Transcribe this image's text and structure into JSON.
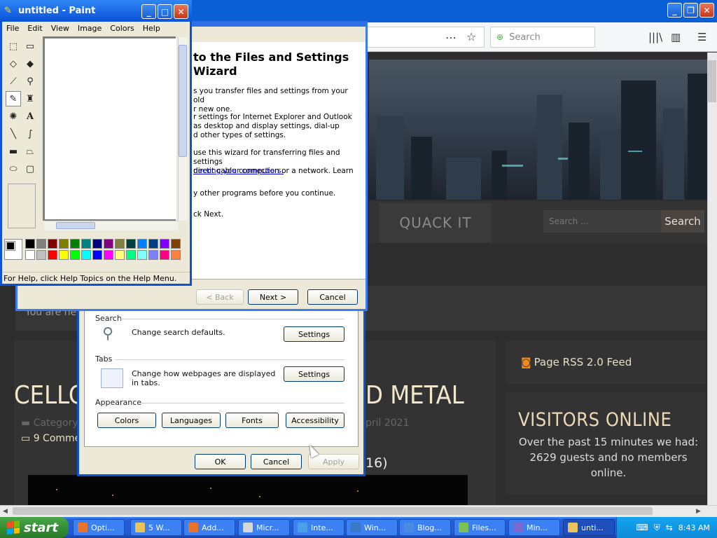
{
  "browser": {
    "search_placeholder": "Search",
    "more_icon": "⋯",
    "bookmark_icon": "☆",
    "library_icon": "|||\\",
    "sidebar_icon": "▥",
    "menu_icon": "☰"
  },
  "site": {
    "nav_item": "QUACK IT",
    "search_placeholder": "Search ...",
    "search_button": "Search",
    "welcome_partial": "You are her",
    "rss_label": "Page RSS 2.0 Feed",
    "visitors_title": "VISITORS ONLINE",
    "visitors_text": "Over the past 15 minutes we had: 2629 guests and no members online.",
    "post_title_left": "CELLO",
    "post_title_right": "D METAL",
    "post_category": "Category",
    "post_date_partial": "pril 2021",
    "post_comments": "9 Comme",
    "post_suffix": "16)"
  },
  "internet_options": {
    "search_group": "Search",
    "search_desc": "Change search defaults.",
    "search_settings": "Settings",
    "tabs_group": "Tabs",
    "tabs_desc": "Change how webpages are displayed in tabs.",
    "tabs_settings": "Settings",
    "appearance_group": "Appearance",
    "colors": "Colors",
    "languages": "Languages",
    "fonts": "Fonts",
    "accessibility": "Accessibility",
    "ok": "OK",
    "cancel": "Cancel",
    "apply": "Apply"
  },
  "wizard": {
    "title_line1": "to the Files and Settings",
    "title_line2": "Wizard",
    "p1": "s you transfer files and settings from your old\nr new one.",
    "p2": "r settings for Internet Explorer and Outlook\nas desktop and display settings, dial-up\nd other types of settings.",
    "p3": "use this wizard for transferring files and settings\ndirect cable connection or a network. Learn",
    "p3_link": "necting your computers.",
    "p4": "y other programs before you continue.",
    "p5": "ck Next.",
    "back": "< Back",
    "next": "Next >",
    "cancel": "Cancel"
  },
  "paint": {
    "title": "untitled - Paint",
    "menus": [
      "File",
      "Edit",
      "View",
      "Image",
      "Colors",
      "Help"
    ],
    "status": "For Help, click Help Topics on the Help Menu.",
    "palette_top": [
      "#000000",
      "#808080",
      "#800000",
      "#808000",
      "#008000",
      "#008080",
      "#000080",
      "#800080",
      "#808040",
      "#004040",
      "#0080ff",
      "#004080",
      "#8000ff",
      "#804000"
    ],
    "palette_bottom": [
      "#ffffff",
      "#c0c0c0",
      "#ff0000",
      "#ffff00",
      "#00ff00",
      "#00ffff",
      "#0000ff",
      "#ff00ff",
      "#ffff80",
      "#00ff80",
      "#80ffff",
      "#8080ff",
      "#ff0080",
      "#ff8040"
    ]
  },
  "taskbar": {
    "start_label": "start",
    "tasks": [
      "Opti...",
      "5 W...",
      "Add...",
      "Micr...",
      "Inte...",
      "Win...",
      "Blog...",
      "Files...",
      "Min...",
      "unti..."
    ],
    "clock": "8:43 AM"
  }
}
